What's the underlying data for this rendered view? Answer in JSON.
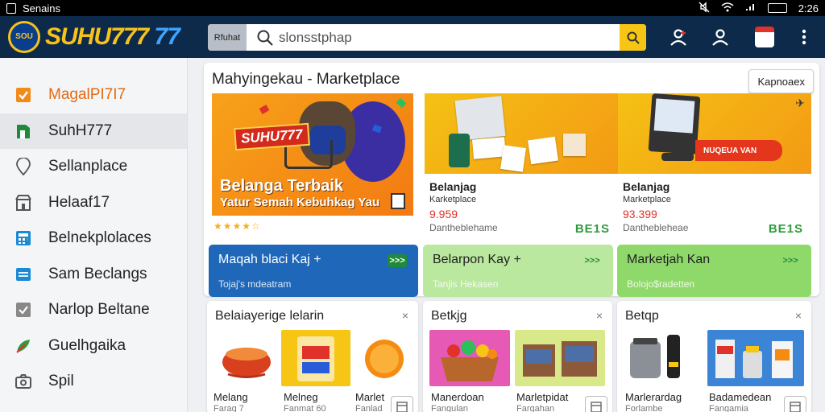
{
  "status_bar": {
    "title": "Senains",
    "time": "2:26"
  },
  "app_bar": {
    "logo_badge": "SOU",
    "logo_text_main": "SUHU777",
    "logo_text_accent": "77",
    "search_scope": "Rfuhat",
    "search_value": "slonsstphap",
    "calendar_count": "1"
  },
  "sidebar": {
    "items": [
      {
        "label": "MagalPI7I7",
        "icon": "checkbox-icon"
      },
      {
        "label": "SuhH777",
        "icon": "bookmark-icon"
      },
      {
        "label": "Sellanplace",
        "icon": "location-pin-icon"
      },
      {
        "label": "Helaaf17",
        "icon": "store-icon"
      },
      {
        "label": "Belnekplolaces",
        "icon": "calculator-icon"
      },
      {
        "label": "Sam Beclangs",
        "icon": "list-icon"
      },
      {
        "label": "Narlop Beltane",
        "icon": "check-square-icon"
      },
      {
        "label": "Guelhgaika",
        "icon": "leaf-icon"
      },
      {
        "label": "Spil",
        "icon": "camera-icon"
      }
    ]
  },
  "hero": {
    "title": "Mahyingekau - Marketplace",
    "action_label": "Kapnoaex",
    "promo": {
      "logo": "SUHU777",
      "title": "Belanga Terbaik",
      "subtitle": "Yatur Semah Kebuhkag Yau",
      "stars": "★★★★☆"
    },
    "products": [
      {
        "name": "Belanjag",
        "category": "Karketplace",
        "price": "9.959",
        "left": "Dantheblehame",
        "badge": "BE1S"
      },
      {
        "name": "Belanjag",
        "category": "Marketplace",
        "price": "93.399",
        "left": "Danthebleheae",
        "badge": "BE1S",
        "banner": "NUQEUA VAN"
      }
    ]
  },
  "categories": [
    {
      "title": "Maqah blaci Kaj +",
      "sub": "Tojaj's mdeatram",
      "arrow": ">>>"
    },
    {
      "title": "Belarpon Kay +",
      "sub": "Tanjis Hekasen",
      "arrow": ">>>"
    },
    {
      "title": "Marketjah Kan",
      "sub": "Bolojo$radetten",
      "arrow": ">>>"
    }
  ],
  "lists": [
    {
      "title": "Belaiayerige lelarin",
      "close": "×",
      "items": [
        {
          "label": "Melang",
          "sub": "Farag 7"
        },
        {
          "label": "Melneg",
          "sub": "Fanmat 60"
        },
        {
          "label": "Marlet",
          "sub": "Fanlad"
        }
      ]
    },
    {
      "title": "Betkjg",
      "close": "×",
      "items": [
        {
          "label": "Manerdoan",
          "sub": "Fangulan"
        },
        {
          "label": "Marletpidat",
          "sub": "Fargahan"
        }
      ]
    },
    {
      "title": "Betqp",
      "close": "×",
      "items": [
        {
          "label": "Marlerardag",
          "sub": "Forlambe"
        },
        {
          "label": "Badamedean",
          "sub": "Fangamia"
        }
      ]
    }
  ],
  "colors": {
    "app_bar": "#0d2a4a",
    "accent_yellow": "#f7c614",
    "tile_blue": "#1e67b8",
    "tile_green_light": "#b9e89e",
    "tile_green": "#8fd86a",
    "badge_green": "#2f9a3c",
    "price_red": "#e0322a"
  }
}
